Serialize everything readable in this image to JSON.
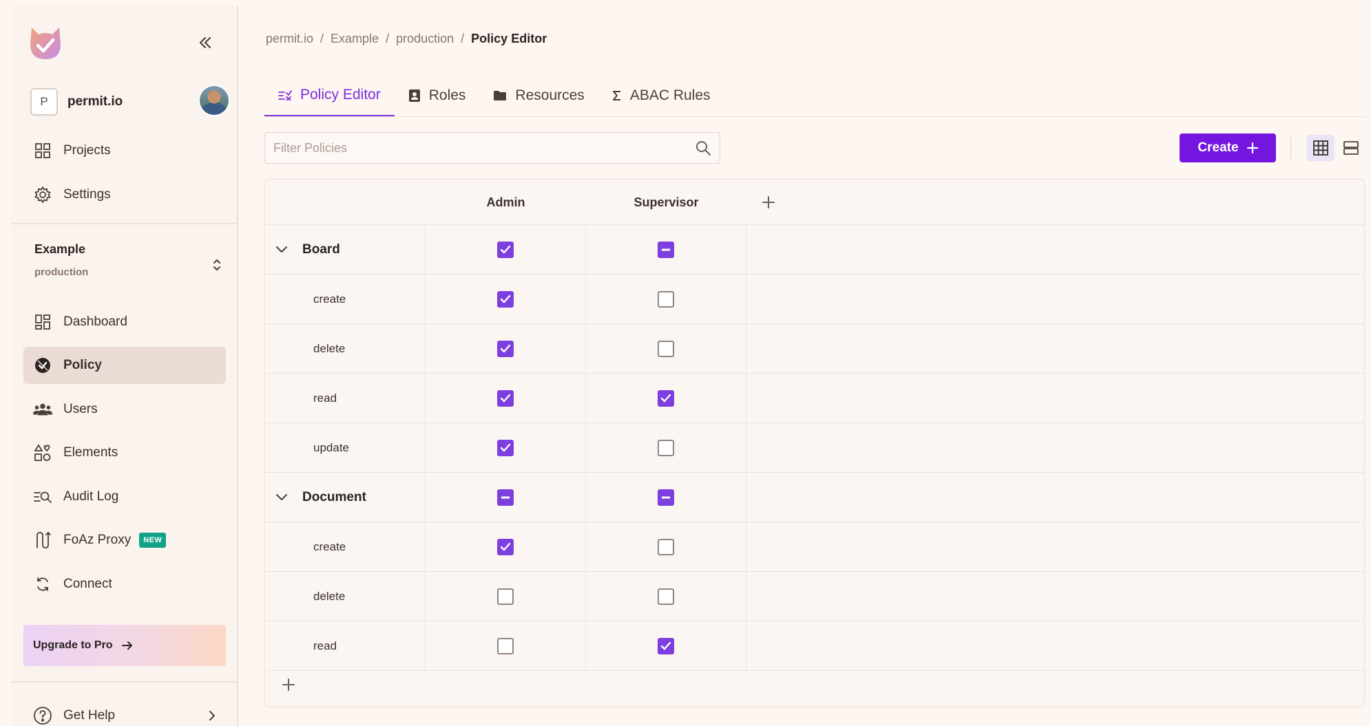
{
  "colors": {
    "accent": "#7516e0",
    "checkbox_on": "#7d3fe0",
    "new_badge": "#13a38b"
  },
  "sidebar": {
    "org": {
      "initial": "P",
      "name": "permit.io"
    },
    "top_items": [
      {
        "label": "Projects",
        "icon": "grid-icon"
      },
      {
        "label": "Settings",
        "icon": "gear-icon"
      }
    ],
    "environment": {
      "project": "Example",
      "env": "production"
    },
    "items": [
      {
        "label": "Dashboard",
        "icon": "dashboard-icon"
      },
      {
        "label": "Policy",
        "icon": "policy-icon",
        "active": true
      },
      {
        "label": "Users",
        "icon": "users-icon"
      },
      {
        "label": "Elements",
        "icon": "elements-icon"
      },
      {
        "label": "Audit Log",
        "icon": "audit-log-icon"
      },
      {
        "label": "FoAz Proxy",
        "icon": "proxy-icon",
        "badge": "NEW"
      },
      {
        "label": "Connect",
        "icon": "connect-icon"
      }
    ],
    "upgrade_label": "Upgrade to Pro",
    "help_label": "Get Help"
  },
  "breadcrumb": [
    "permit.io",
    "Example",
    "production",
    "Policy Editor"
  ],
  "tabs": [
    {
      "label": "Policy Editor",
      "icon": "policy-editor-icon",
      "active": true
    },
    {
      "label": "Roles",
      "icon": "roles-icon"
    },
    {
      "label": "Resources",
      "icon": "folder-icon"
    },
    {
      "label": "ABAC Rules",
      "icon": "sigma-icon"
    }
  ],
  "filter": {
    "placeholder": "Filter Policies",
    "value": ""
  },
  "create_label": "Create",
  "table": {
    "roles": [
      "Admin",
      "Supervisor"
    ],
    "rows": [
      {
        "type": "resource",
        "name": "Board",
        "values": [
          "checked",
          "partial"
        ]
      },
      {
        "type": "action",
        "name": "create",
        "values": [
          "checked",
          "unchecked"
        ]
      },
      {
        "type": "action",
        "name": "delete",
        "values": [
          "checked",
          "unchecked"
        ]
      },
      {
        "type": "action",
        "name": "read",
        "values": [
          "checked",
          "checked"
        ]
      },
      {
        "type": "action",
        "name": "update",
        "values": [
          "checked",
          "unchecked"
        ]
      },
      {
        "type": "resource",
        "name": "Document",
        "values": [
          "partial",
          "partial"
        ]
      },
      {
        "type": "action",
        "name": "create",
        "values": [
          "checked",
          "unchecked"
        ]
      },
      {
        "type": "action",
        "name": "delete",
        "values": [
          "unchecked",
          "unchecked"
        ]
      },
      {
        "type": "action",
        "name": "read",
        "values": [
          "unchecked",
          "checked"
        ]
      }
    ]
  }
}
